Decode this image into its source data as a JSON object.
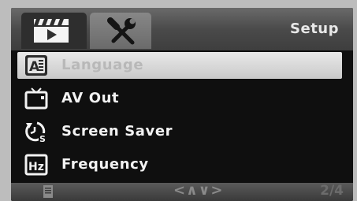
{
  "header": {
    "title": "Setup",
    "tabs": [
      {
        "icon": "video-icon",
        "active": false
      },
      {
        "icon": "tools-icon",
        "active": true
      }
    ]
  },
  "menu": {
    "items": [
      {
        "label": "Language",
        "icon": "language-icon",
        "selected": true
      },
      {
        "label": "AV Out",
        "icon": "tv-icon",
        "selected": false
      },
      {
        "label": "Screen Saver",
        "icon": "screensaver-icon",
        "selected": false
      },
      {
        "label": "Frequency",
        "icon": "frequency-icon",
        "selected": false
      }
    ],
    "icon_text": {
      "language": "A",
      "frequency": "Hz",
      "screensaver": "S"
    }
  },
  "footer": {
    "nav": "<∧∨>",
    "page": "2/4"
  }
}
